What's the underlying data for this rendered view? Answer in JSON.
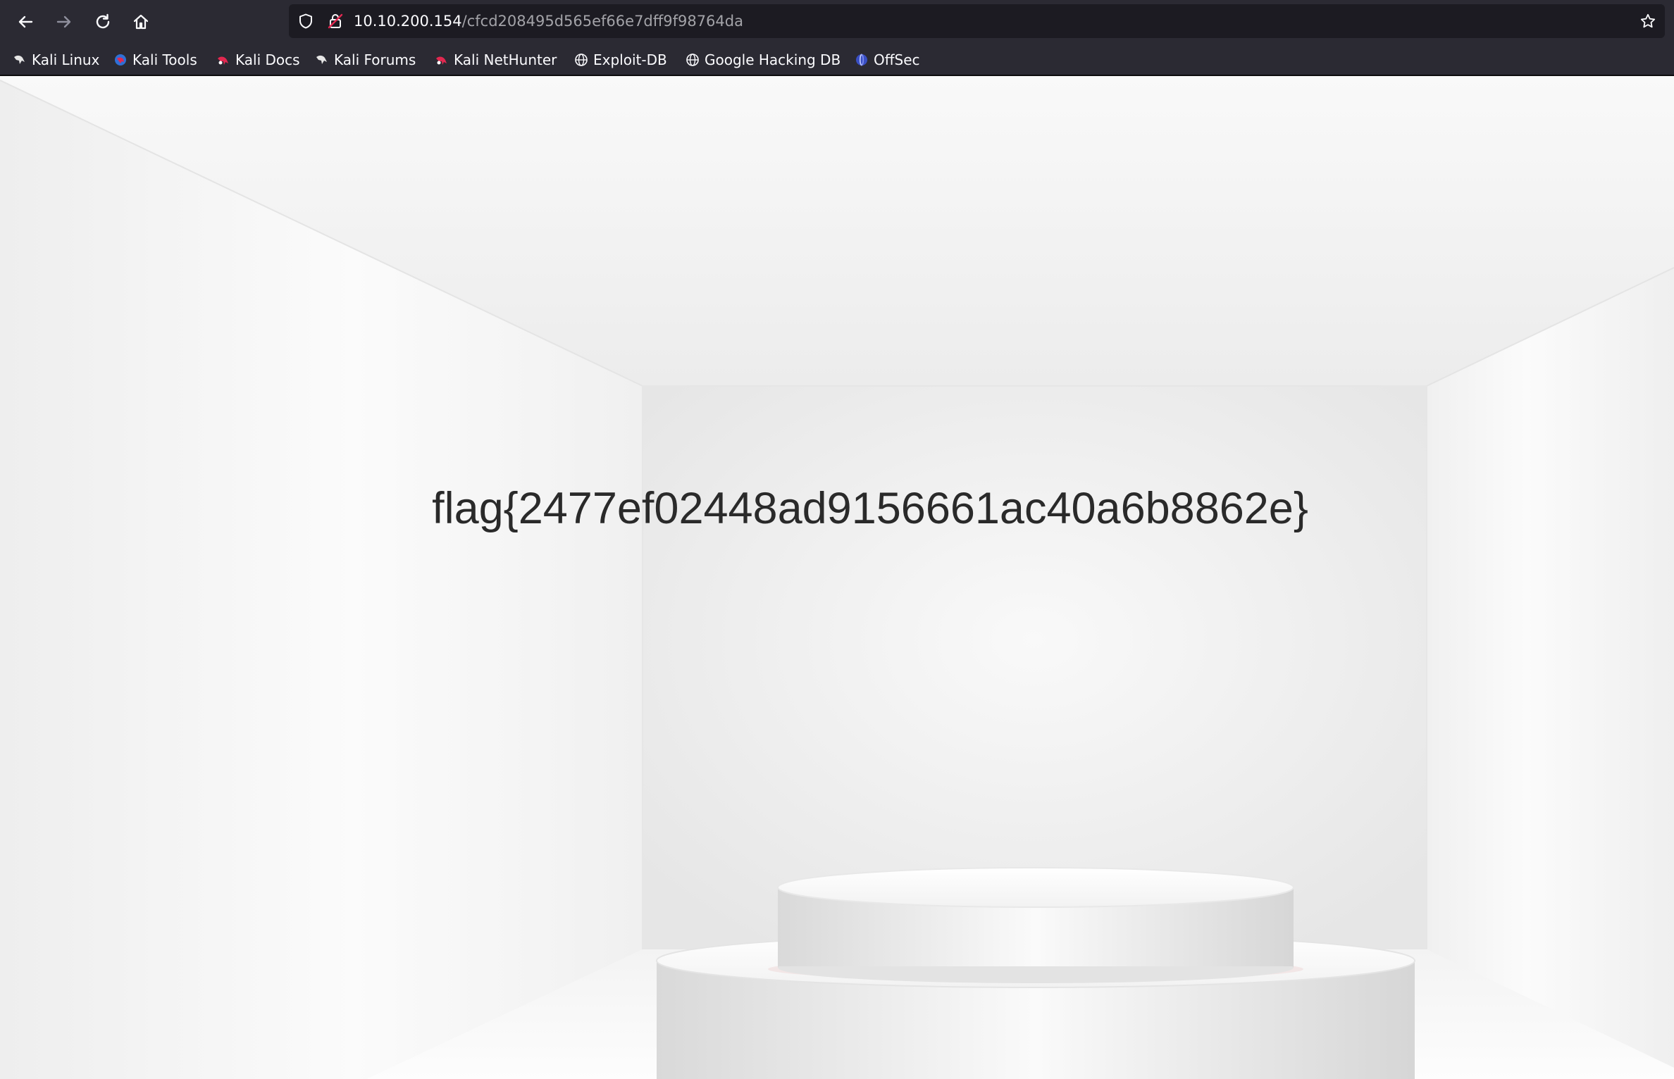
{
  "browser": {
    "nav": {
      "back_icon": "arrow-left-icon",
      "forward_icon": "arrow-right-icon",
      "reload_icon": "reload-icon",
      "home_icon": "home-icon"
    },
    "address_bar": {
      "host": "10.10.200.154",
      "path": "/cfcd208495d565ef66e7dff9f98764da",
      "shield_icon": "tracking-protection-shield-icon",
      "lock_icon": "insecure-lock-icon",
      "star_icon": "bookmark-star-icon"
    },
    "bookmarks": [
      {
        "label": "Kali Linux",
        "icon": "kali-dragon-icon"
      },
      {
        "label": "Kali Tools",
        "icon": "kali-tools-icon"
      },
      {
        "label": "Kali Docs",
        "icon": "kali-red-dragon-icon"
      },
      {
        "label": "Kali Forums",
        "icon": "kali-dragon-icon"
      },
      {
        "label": "Kali NetHunter",
        "icon": "kali-red-dragon-icon"
      },
      {
        "label": "Exploit-DB",
        "icon": "globe-icon"
      },
      {
        "label": "Google Hacking DB",
        "icon": "globe-icon"
      },
      {
        "label": "OffSec",
        "icon": "offsec-icon"
      }
    ]
  },
  "page": {
    "flag": "flag{2477ef02448ad9156661ac40a6b8862e}"
  },
  "colors": {
    "toolbar_bg": "#2b2a33",
    "urlbar_bg": "#1c1b22",
    "page_text": "#2a2a2a",
    "room_light": "#f4f4f4"
  }
}
